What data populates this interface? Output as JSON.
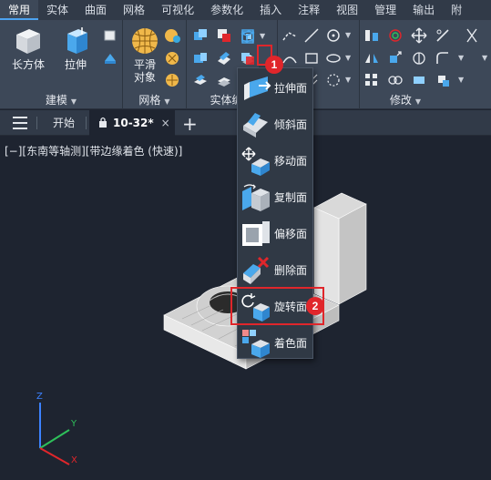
{
  "ribbon_tabs": [
    "常用",
    "实体",
    "曲面",
    "网格",
    "可视化",
    "参数化",
    "插入",
    "注释",
    "视图",
    "管理",
    "输出",
    "附"
  ],
  "ribbon": {
    "modeling_panel": {
      "box_label": "长方体",
      "extrude_label": "拉伸",
      "title": "建模"
    },
    "mesh_panel": {
      "smooth_object_label_line1": "平滑",
      "smooth_object_label_line2": "对象",
      "title": "网格"
    },
    "solid_edit_panel": {
      "title": "实体编辑"
    },
    "modify_panel": {
      "title": "修改"
    }
  },
  "document_tabs": {
    "start_label": "开始",
    "drawing_label": "10-32*",
    "close_glyph": "×",
    "add_glyph": "+"
  },
  "viewport_label": "[−][东南等轴测][带边缘着色 (快速)]",
  "face_edit_menu": {
    "items": [
      {
        "label": "拉伸面",
        "icon": "extrude-face-icon"
      },
      {
        "label": "倾斜面",
        "icon": "taper-face-icon"
      },
      {
        "label": "移动面",
        "icon": "move-face-icon"
      },
      {
        "label": "复制面",
        "icon": "copy-face-icon"
      },
      {
        "label": "偏移面",
        "icon": "offset-face-icon"
      },
      {
        "label": "删除面",
        "icon": "delete-face-icon"
      },
      {
        "label": "旋转面",
        "icon": "rotate-face-icon"
      },
      {
        "label": "着色面",
        "icon": "color-face-icon"
      }
    ]
  },
  "annotations": {
    "step1_badge": "1",
    "step2_badge": "2",
    "highlight_color": "#e0262b"
  },
  "ucs": {
    "x_label": "X",
    "y_label": "Y",
    "z_label": "Z"
  },
  "colors": {
    "accent": "#4da3f0",
    "canvas_background": "#1e2430",
    "ribbon_background": "#3d4858"
  }
}
